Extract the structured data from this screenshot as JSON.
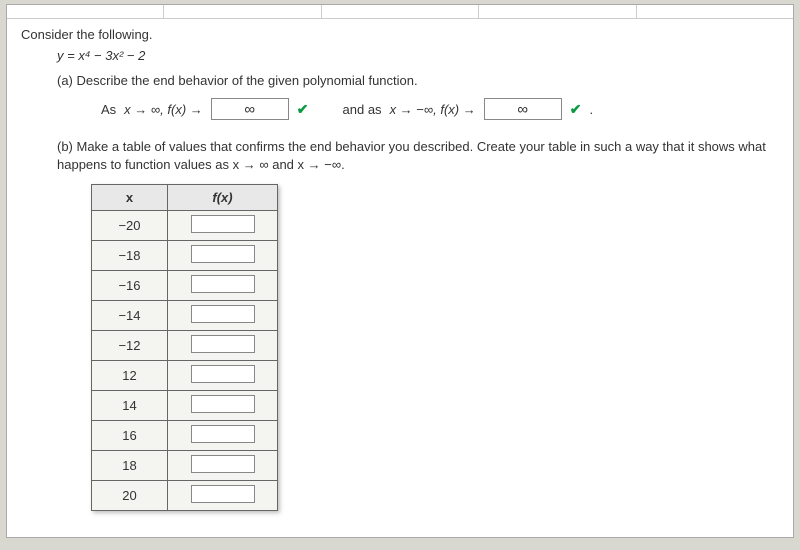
{
  "header": {
    "prompt": "Consider the following."
  },
  "equation": "y = x⁴ − 3x² − 2",
  "parts": {
    "a": {
      "label": "(a) Describe the end behavior of the given polynomial function.",
      "row": {
        "lhs1_prefix": "As  ",
        "lhs1_math": "x → ∞, f(x) →",
        "ans1": "∞",
        "rhs_prefix": "and as ",
        "rhs_math": "x → −∞, f(x) →",
        "ans2": "∞"
      }
    },
    "b": {
      "label_line1": "(b) Make a table of values that confirms the end behavior you described. Create your table in such a way that it shows what",
      "label_line2": "happens to function values as  x → ∞  and  x → −∞.",
      "table": {
        "head_x": "x",
        "head_fx": "f(x)",
        "rows": [
          {
            "x": "−20",
            "fx": ""
          },
          {
            "x": "−18",
            "fx": ""
          },
          {
            "x": "−16",
            "fx": ""
          },
          {
            "x": "−14",
            "fx": ""
          },
          {
            "x": "−12",
            "fx": ""
          },
          {
            "x": "12",
            "fx": ""
          },
          {
            "x": "14",
            "fx": ""
          },
          {
            "x": "16",
            "fx": ""
          },
          {
            "x": "18",
            "fx": ""
          },
          {
            "x": "20",
            "fx": ""
          }
        ]
      }
    }
  },
  "icons": {
    "check": "✔"
  }
}
